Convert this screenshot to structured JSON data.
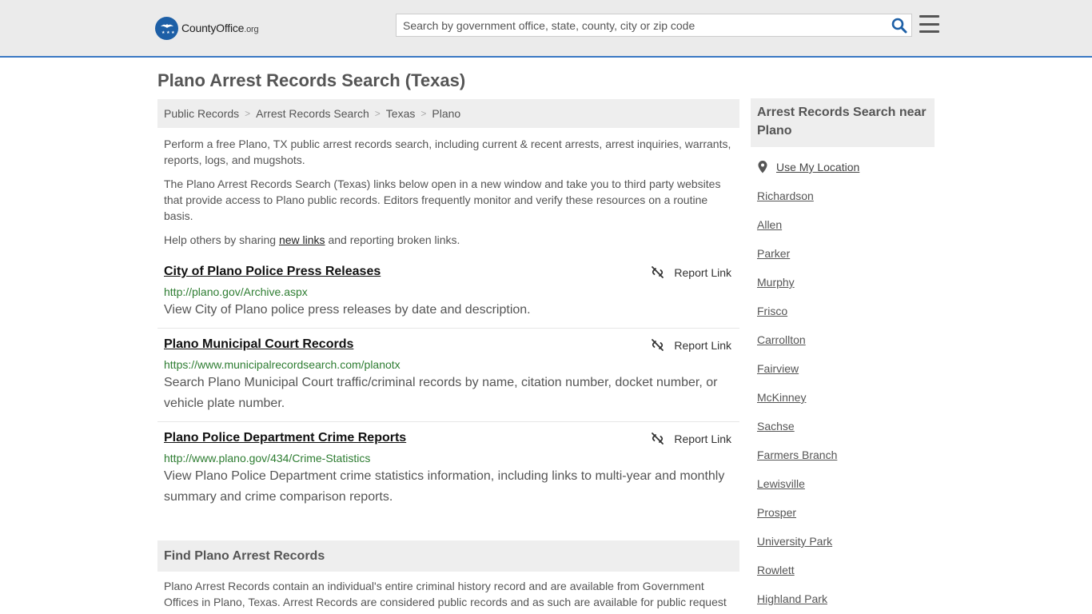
{
  "header": {
    "logo_name": "CountyOffice",
    "logo_tld": ".org",
    "search_placeholder": "Search by government office, state, county, city or zip code",
    "brand_color": "#3a78c3"
  },
  "page_title": "Plano Arrest Records Search (Texas)",
  "breadcrumb": [
    "Public Records",
    "Arrest Records Search",
    "Texas",
    "Plano"
  ],
  "intro": {
    "p1": "Perform a free Plano, TX public arrest records search, including current & recent arrests, arrest inquiries, warrants, reports, logs, and mugshots.",
    "p2": "The Plano Arrest Records Search (Texas) links below open in a new window and take you to third party websites that provide access to Plano public records. Editors frequently monitor and verify these resources on a routine basis.",
    "p3_before": "Help others by sharing ",
    "p3_link": "new links",
    "p3_after": " and reporting broken links."
  },
  "report_label": "Report Link",
  "results": [
    {
      "title": "City of Plano Police Press Releases",
      "url": "http://plano.gov/Archive.aspx",
      "description": "View City of Plano police press releases by date and description."
    },
    {
      "title": "Plano Municipal Court Records",
      "url": "https://www.municipalrecordsearch.com/planotx",
      "description": "Search Plano Municipal Court traffic/criminal records by name, citation number, docket number, or vehicle plate number."
    },
    {
      "title": "Plano Police Department Crime Reports",
      "url": "http://www.plano.gov/434/Crime-Statistics",
      "description": "View Plano Police Department crime statistics information, including links to multi-year and monthly summary and crime comparison reports."
    }
  ],
  "find": {
    "header": "Find Plano Arrest Records",
    "text": "Plano Arrest Records contain an individual's entire criminal history record and are available from Government Offices in Plano, Texas. Arrest Records are considered public records and as such are available for public request"
  },
  "sidebar": {
    "header": "Arrest Records Search near Plano",
    "use_location": "Use My Location",
    "cities": [
      "Richardson",
      "Allen",
      "Parker",
      "Murphy",
      "Frisco",
      "Carrollton",
      "Fairview",
      "McKinney",
      "Sachse",
      "Farmers Branch",
      "Lewisville",
      "Prosper",
      "University Park",
      "Rowlett",
      "Highland Park"
    ]
  }
}
